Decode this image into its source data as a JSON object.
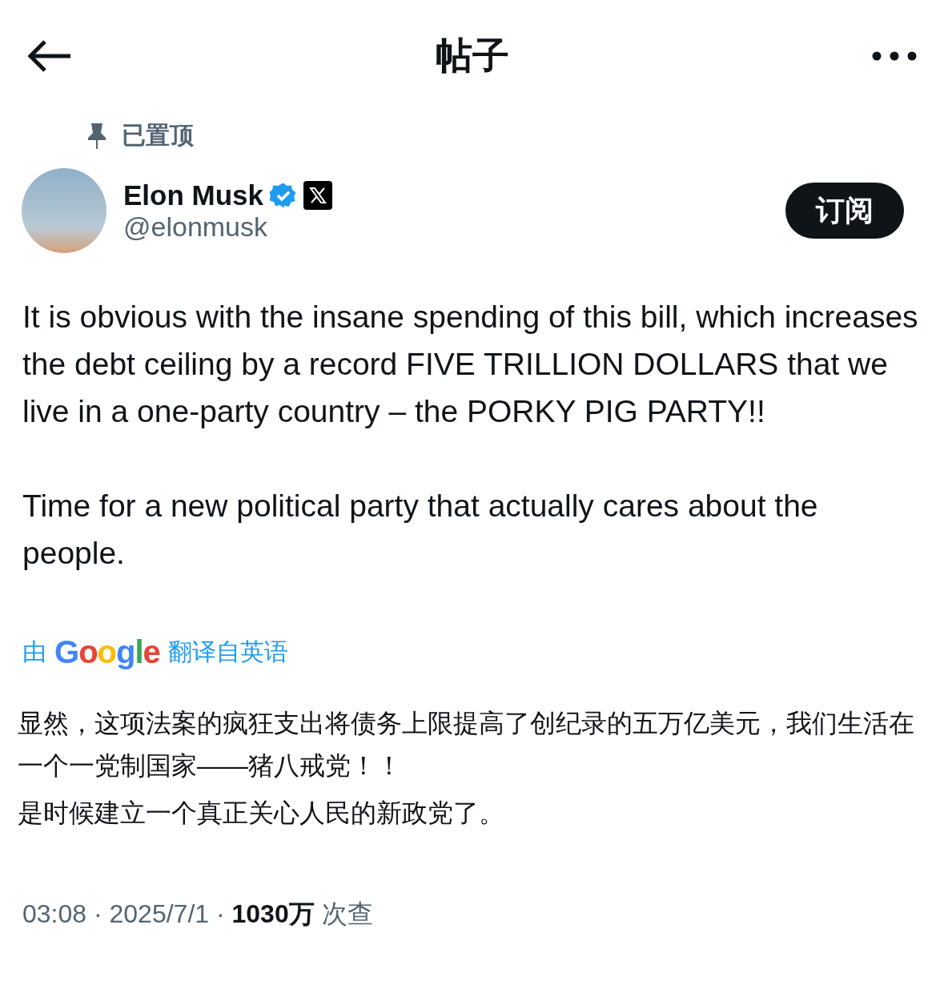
{
  "header": {
    "title": "帖子"
  },
  "pinned": {
    "label": "已置顶"
  },
  "author": {
    "name": "Elon Musk",
    "handle": "@elonmusk",
    "verified": true,
    "subscribe": "订阅"
  },
  "body": [
    "It is obvious with the insane spending of this bill, which increases the debt ceiling by a record FIVE TRILLION DOLLARS that we live in a one-party country – the PORKY PIG PARTY!!",
    "Time for a new political party that actually cares about the people."
  ],
  "translation": {
    "prefix": "由",
    "brand": "Google",
    "suffix": "翻译自英语",
    "paragraphs": [
      "显然，这项法案的疯狂支出将债务上限提高了创纪录的五万亿美元，我们生活在一个一党制国家——猪八戒党！！",
      "是时候建立一个真正关心人民的新政党了。"
    ]
  },
  "meta": "03:08 · 2025/7/1 · **1030万** 次查"
}
